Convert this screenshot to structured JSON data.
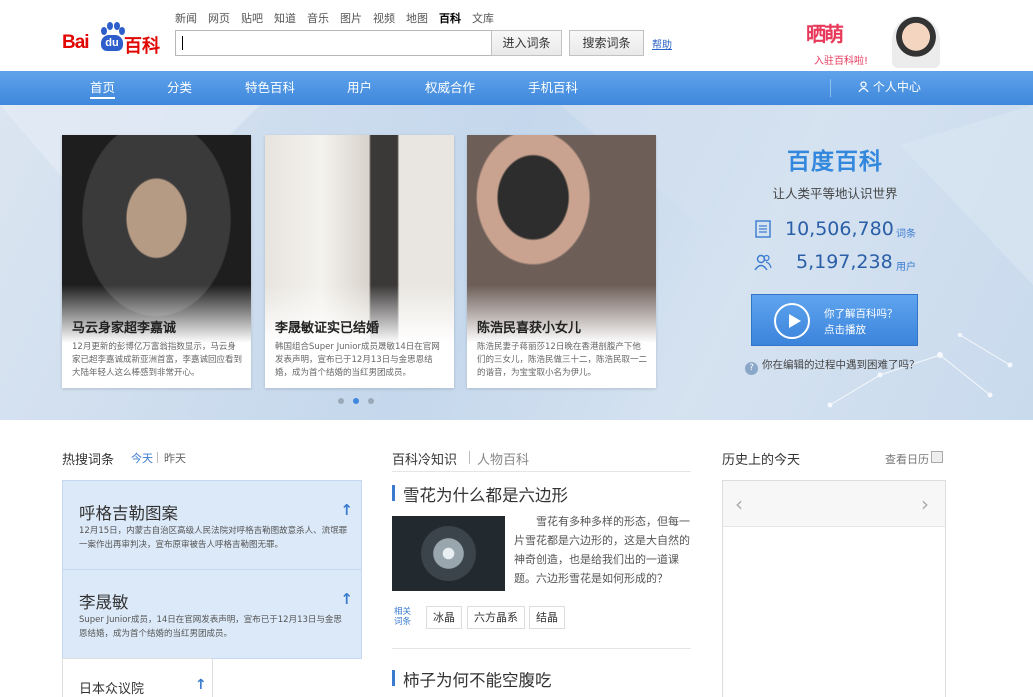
{
  "header": {
    "logo_left": "Bai",
    "logo_du": "du",
    "logo_right": "百科",
    "topnav": [
      "新闻",
      "网页",
      "贴吧",
      "知道",
      "音乐",
      "图片",
      "视频",
      "地图",
      "百科",
      "文库"
    ],
    "topnav_current": "百科",
    "search_value": "",
    "enter_label": "进入词条",
    "search_label": "搜索词条",
    "help_label": "帮助",
    "promo_big": "晒萌",
    "promo_sub": "入驻百科啦!"
  },
  "mainnav": {
    "items": [
      "首页",
      "分类",
      "特色百科",
      "用户",
      "权威合作",
      "手机百科"
    ],
    "current": "首页",
    "user_center": "个人中心"
  },
  "hero": {
    "cards": [
      {
        "title": "马云身家超李嘉诚",
        "desc": "12月更新的彭博亿万富翁指数显示，马云身家已超李嘉诚成新亚洲首富，李嘉诚回应看到大陆年轻人这么棒感到非常开心。"
      },
      {
        "title": "李晟敏证实已结婚",
        "desc": "韩国组合Super Junior成员晟敏14日在官网发表声明，宣布已于12月13日与金思恩结婚，成为首个结婚的当红男团成员。"
      },
      {
        "title": "陈浩民喜获小女儿",
        "desc": "陈浩民妻子蒋丽莎12日晚在香港剖腹产下他们的三女儿，陈浩民做三十二，陈浩民取一二的谐音，为宝宝取小名为伊儿。"
      }
    ],
    "carousel_active": 1,
    "brand_title": "百度百科",
    "brand_slogan": "让人类平等地认识世界",
    "entries_count": "10,506,780",
    "entries_unit": "词条",
    "users_count": "5,197,238",
    "users_unit": "用户",
    "play_line1": "你了解百科吗？",
    "play_line2": "点击播放",
    "help_question": "你在编辑的过程中遇到困难了吗？"
  },
  "hot": {
    "heading": "热搜词条",
    "tab_today": "今天",
    "tab_yesterday": "昨天",
    "items": [
      {
        "title": "呼格吉勒图案",
        "desc": "12月15日，内蒙古自治区高级人民法院对呼格吉勒图故意杀人、流氓罪一案作出再审判决，宣布原审被告人呼格吉勒图无罪。"
      },
      {
        "title": "李晟敏",
        "desc": "Super Junior成员，14日在官网发表声明，宣布已于12月13日与金思恩结婚，成为首个结婚的当红男团成员。"
      },
      {
        "title": "日本众议院",
        "desc": ""
      }
    ]
  },
  "knowledge": {
    "tab_active": "百科冷知识",
    "tab_other": "人物百科",
    "article1_title": "雪花为什么都是六边形",
    "article1_text": "雪花有多种多样的形态，但每一片雪花都是六边形的，这是大自然的神奇创造，也是给我们出的一道课题。六边形雪花是如何形成的？",
    "related_label": "相关词条",
    "tags": [
      "冰晶",
      "六方晶系",
      "结晶"
    ],
    "article2_title": "柿子为何不能空腹吃"
  },
  "history": {
    "heading": "历史上的今天",
    "calendar_link": "查看日历"
  },
  "colors": {
    "brand_red": "#e10601",
    "brand_blue": "#2e5ecb",
    "nav_blue": "#3f87dc",
    "accent_pink": "#e8395a"
  }
}
